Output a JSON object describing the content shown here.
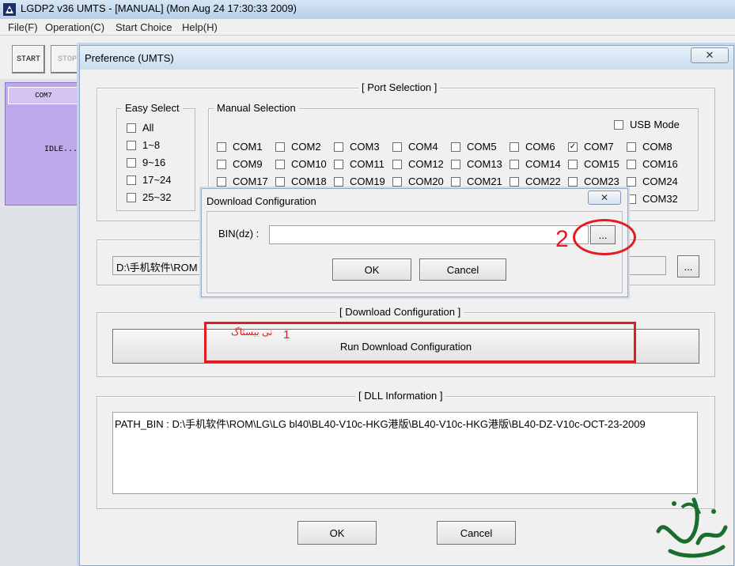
{
  "app": {
    "title": "LGDP2 v36 UMTS - [MANUAL] (Mon Aug 24 17:30:33 2009)",
    "menu": [
      "File(F)",
      "Operation(C)",
      "Start Choice",
      "Help(H)"
    ],
    "toolbar": {
      "start": "START",
      "stop": "STOP"
    },
    "port": {
      "name": "COM7",
      "status": "IDLE..."
    }
  },
  "preference": {
    "title": "Preference (UMTS)",
    "close_glyph": "✕",
    "port_selection": {
      "legend": "[ Port Selection ]",
      "easy_select": {
        "legend": "Easy Select",
        "items": [
          "All",
          "1~8",
          "9~16",
          "17~24",
          "25~32"
        ]
      },
      "manual_selection": {
        "legend": "Manual Selection",
        "usb_mode": "USB Mode",
        "row1": [
          "COM1",
          "COM2",
          "COM3",
          "COM4",
          "COM5",
          "COM6",
          "COM7",
          "COM8"
        ],
        "row2": [
          "COM9",
          "COM10",
          "COM11",
          "COM12",
          "COM13",
          "COM14",
          "COM15",
          "COM16"
        ],
        "row3": [
          "COM17",
          "COM18",
          "COM19",
          "COM20",
          "COM21",
          "COM22",
          "COM23",
          "COM24"
        ],
        "row4_last": "COM32",
        "checked": "COM7"
      }
    },
    "path": {
      "value": "D:\\手机软件\\ROM",
      "browse": "..."
    },
    "download_config": {
      "legend": "[ Download Configuration ]",
      "run_button": "Run Download Configuration"
    },
    "dll_info": {
      "legend": "[ DLL Information ]",
      "text": "PATH_BIN : D:\\手机软件\\ROM\\LG\\LG bl40\\BL40-V10c-HKG港版\\BL40-V10c-HKG港版\\BL40-DZ-V10c-OCT-23-2009"
    },
    "ok": "OK",
    "cancel": "Cancel"
  },
  "download_dialog": {
    "title": "Download Configuration",
    "close_glyph": "✕",
    "bin_label": "BIN(dz) :",
    "bin_value": "",
    "browse": "...",
    "ok": "OK",
    "cancel": "Cancel"
  },
  "annotations": {
    "step1": "1",
    "step1_arabic": "نی ببستاگ",
    "step2": "2",
    "color": "#e01b22"
  }
}
